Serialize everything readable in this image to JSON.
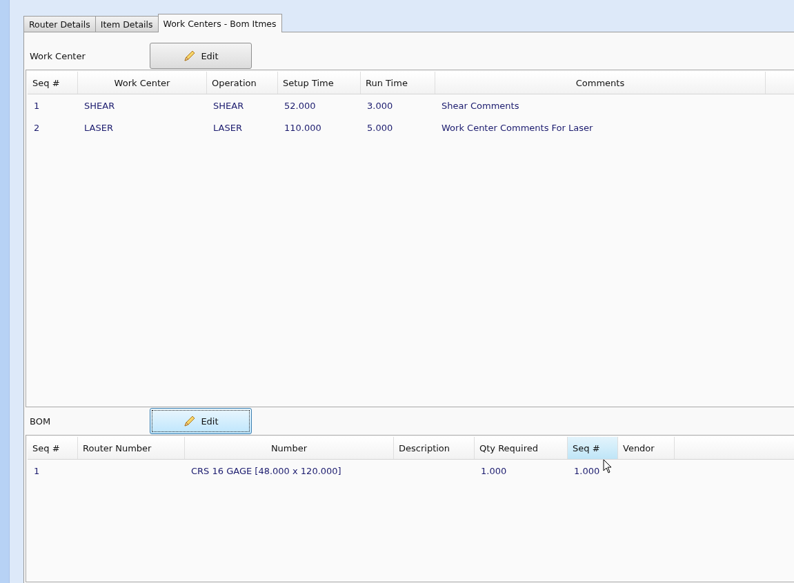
{
  "tabs": [
    {
      "label": "Router Details",
      "selected": false
    },
    {
      "label": "Item Details",
      "selected": false
    },
    {
      "label": "Work Centers - Bom Itmes",
      "selected": true
    }
  ],
  "work_center": {
    "label": "Work Center",
    "edit_button": {
      "label": "Edit",
      "focused": false
    },
    "columns": [
      {
        "label": "Seq #",
        "highlighted": false
      },
      {
        "label": "Work Center",
        "highlighted": false
      },
      {
        "label": "Operation",
        "highlighted": false
      },
      {
        "label": "Setup Time",
        "highlighted": false
      },
      {
        "label": "Run Time",
        "highlighted": false
      },
      {
        "label": "Comments",
        "highlighted": false
      }
    ],
    "rows": [
      [
        "1",
        "SHEAR",
        "SHEAR",
        "52.000",
        "3.000",
        "Shear Comments"
      ],
      [
        "2",
        "LASER",
        "LASER",
        "110.000",
        "5.000",
        "Work Center Comments For Laser"
      ]
    ]
  },
  "bom": {
    "label": "BOM",
    "edit_button": {
      "label": "Edit",
      "focused": true
    },
    "columns": [
      {
        "label": "Seq #",
        "highlighted": false
      },
      {
        "label": "Router Number",
        "highlighted": false
      },
      {
        "label": "Number",
        "highlighted": false
      },
      {
        "label": "Description",
        "highlighted": false
      },
      {
        "label": "Qty Required",
        "highlighted": false
      },
      {
        "label": "Seq #",
        "highlighted": true
      },
      {
        "label": "Vendor",
        "highlighted": false
      }
    ],
    "rows": [
      [
        "1",
        "",
        "CRS 16 GAGE [48.000 x 120.000]",
        "",
        "1.000",
        "1.000",
        ""
      ]
    ]
  }
}
